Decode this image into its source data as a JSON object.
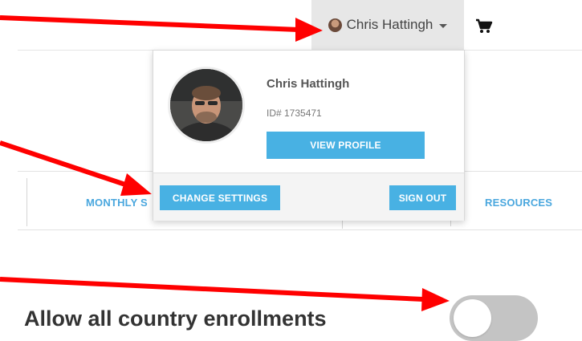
{
  "header": {
    "user_name": "Chris Hattingh",
    "cart_icon": "cart-icon"
  },
  "nav": {
    "items": [
      "MONTHLY S",
      "RESOURCES"
    ]
  },
  "dropdown": {
    "name": "Chris Hattingh",
    "id_text": "ID# 1735471",
    "view_profile_label": "VIEW PROFILE",
    "change_settings_label": "CHANGE SETTINGS",
    "sign_out_label": "SIGN OUT"
  },
  "settings": {
    "allow_country_label": "Allow all country enrollments",
    "allow_country_enabled": false
  },
  "colors": {
    "accent": "#48b1e3",
    "nav_text": "#4aa7de",
    "annotation": "#ff0000",
    "toggle_off": "#c4c4c4"
  }
}
